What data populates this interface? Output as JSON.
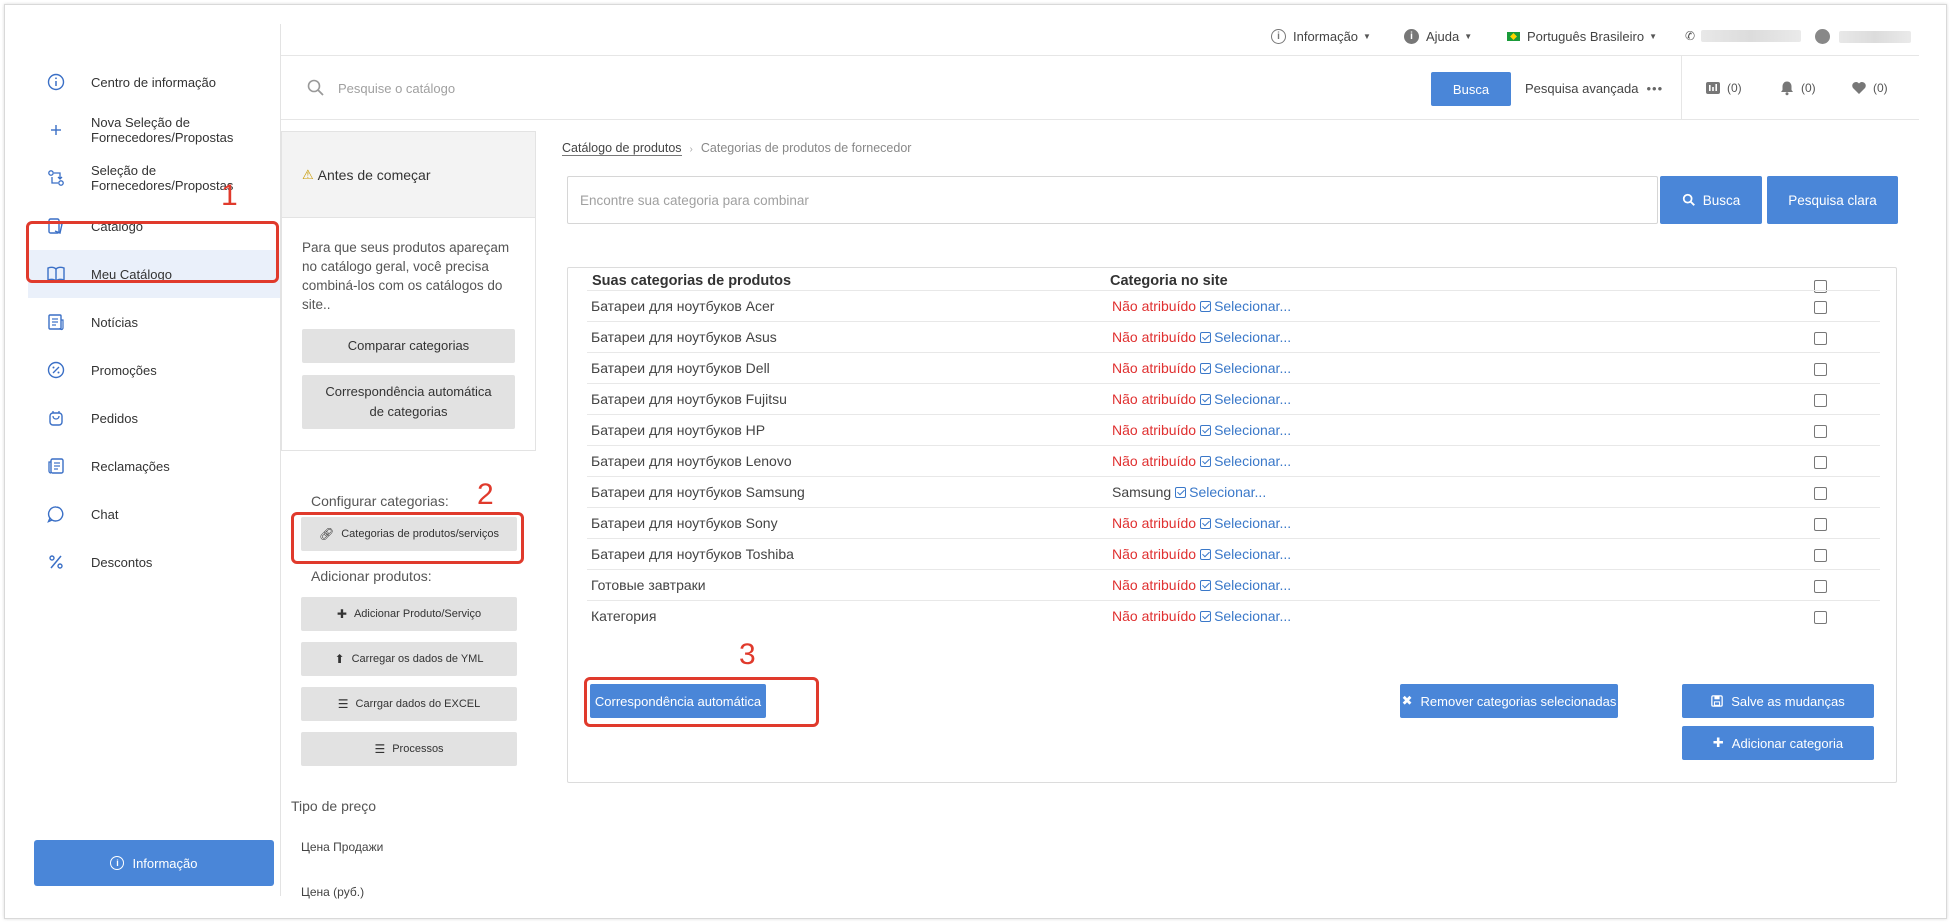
{
  "sidebar": {
    "items": [
      {
        "label": "Centro de informação",
        "icon": "info-circle-icon"
      },
      {
        "label": "Nova Seleção de Fornecedores/Propostas",
        "icon": "plus-icon"
      },
      {
        "label": "Seleção de Fornecedores/Propostas",
        "icon": "exchange-icon"
      },
      {
        "label": "Catálogo",
        "icon": "catalog-icon"
      },
      {
        "label": "Meu Catálogo",
        "icon": "book-icon"
      },
      {
        "label": "Notícias",
        "icon": "news-icon"
      },
      {
        "label": "Promoções",
        "icon": "percent-badge-icon"
      },
      {
        "label": "Pedidos",
        "icon": "bag-icon"
      },
      {
        "label": "Reclamações",
        "icon": "complaint-icon"
      },
      {
        "label": "Chat",
        "icon": "chat-icon"
      },
      {
        "label": "Descontos",
        "icon": "percent-icon"
      }
    ],
    "active_item": "Meu Catálogo",
    "info_button": "Informação"
  },
  "topbar": {
    "information": "Informação",
    "help": "Ajuda",
    "language": "Português Brasileiro"
  },
  "search": {
    "placeholder": "Pesquise o catálogo",
    "button": "Busca",
    "advanced": "Pesquisa avançada",
    "compare_count": "(0)",
    "notifications_count": "(0)",
    "favorites_count": "(0)"
  },
  "left_panel": {
    "before_title": "Antes de começar",
    "before_text": "Para que seus produtos apareçam no catálogo geral, você precisa combiná-los com os catálogos do site..",
    "compare_button": "Comparar categorias",
    "auto_match_button": "Correspondência automática de categorias",
    "configure_label": "Configurar categorias:",
    "categories_button": "Categorias de produtos/serviços",
    "add_products_label": "Adicionar produtos:",
    "add_product_button": "Adicionar Produto/Serviço",
    "yml_button": "Carregar os dados de YML",
    "excel_button": "Carrgar dados do EXCEL",
    "processes_button": "Processos",
    "price_type_label": "Tipo de preço",
    "price_items": [
      "Цена Продажи",
      "Цена (руб.)"
    ]
  },
  "main": {
    "breadcrumb": [
      "Catálogo de produtos",
      "Categorias de produtos de fornecedor"
    ],
    "category_search_placeholder": "Encontre sua categoria para combinar",
    "search_button": "Busca",
    "clear_button": "Pesquisa clara",
    "table": {
      "col_categories": "Suas categorias de produtos",
      "col_site_category": "Categoria no site",
      "select_link": "Selecionar...",
      "rows": [
        {
          "name": "Батареи для ноутбуков Acer",
          "status": "Não atribuído",
          "assigned": false
        },
        {
          "name": "Батареи для ноутбуков Asus",
          "status": "Não atribuído",
          "assigned": false
        },
        {
          "name": "Батареи для ноутбуков Dell",
          "status": "Não atribuído",
          "assigned": false
        },
        {
          "name": "Батареи для ноутбуков Fujitsu",
          "status": "Não atribuído",
          "assigned": false
        },
        {
          "name": "Батареи для ноутбуков HP",
          "status": "Não atribuído",
          "assigned": false
        },
        {
          "name": "Батареи для ноутбуков Lenovo",
          "status": "Não atribuído",
          "assigned": false
        },
        {
          "name": "Батареи для ноутбуков Samsung",
          "status": "Samsung",
          "assigned": true
        },
        {
          "name": "Батареи для ноутбуков Sony",
          "status": "Não atribuído",
          "assigned": false
        },
        {
          "name": "Батареи для ноутбуков Toshiba",
          "status": "Não atribuído",
          "assigned": false
        },
        {
          "name": "Готовые завтраки",
          "status": "Não atribuído",
          "assigned": false
        },
        {
          "name": "Категория",
          "status": "Não atribuído",
          "assigned": false
        }
      ]
    },
    "auto_match_button": "Correspondência automática",
    "remove_button": "Remover categorias selecionadas",
    "save_button": "Salve as mudanças",
    "add_category_button": "Adicionar categoria"
  },
  "annotations": [
    "1",
    "2",
    "3"
  ],
  "colors": {
    "accent": "#4a86d8",
    "annotation": "#e03a2c",
    "unassigned": "#e03030",
    "link": "#3a78c9"
  }
}
